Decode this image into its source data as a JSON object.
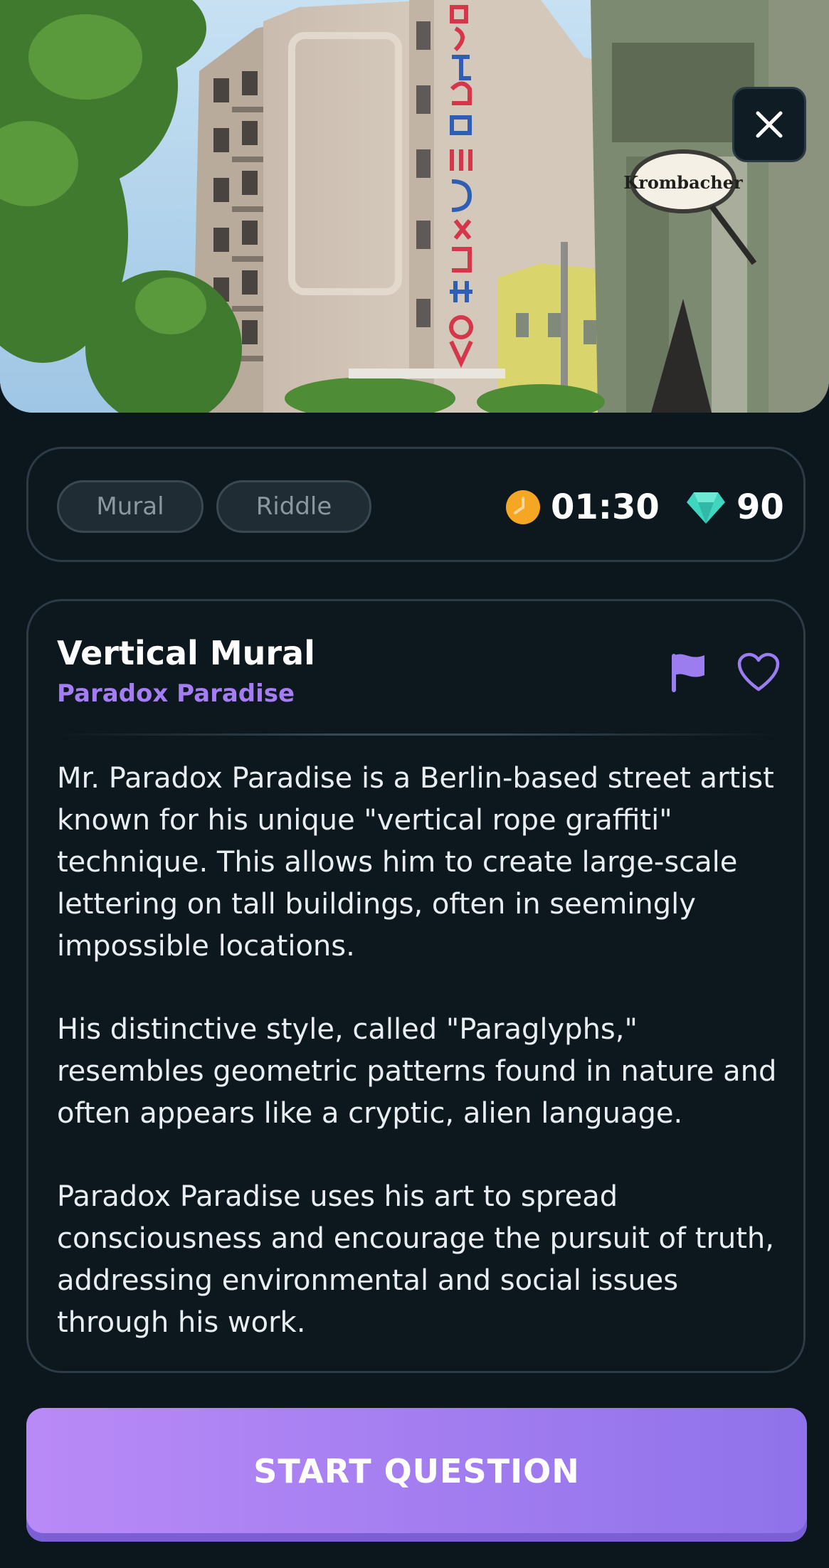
{
  "hero": {
    "image": "street-scene-photo",
    "sign_text": "Krombacher",
    "close_icon": "close-icon"
  },
  "meta": {
    "tags": [
      "Mural",
      "Riddle"
    ],
    "timer": "01:30",
    "timer_icon": "clock-icon",
    "gems": "90",
    "gems_icon": "diamond-icon"
  },
  "content": {
    "title": "Vertical Mural",
    "artist": "Paradox Paradise",
    "flag_icon": "flag-icon",
    "favorite_icon": "heart-icon",
    "paragraphs": [
      "Mr. Paradox Paradise is a Berlin-based street artist known for his unique \"vertical rope graffiti\" technique. This allows him to create large-scale lettering on tall buildings, often in seemingly impossible locations.",
      "His distinctive style, called \"Paraglyphs,\" resembles geometric patterns found in nature and often appears like a cryptic, alien language.",
      "Paradox Paradise uses his art to spread consciousness and encourage the pursuit of truth, addressing environmental and social issues through his work."
    ]
  },
  "cta": {
    "label": "START QUESTION"
  },
  "colors": {
    "background": "#0b161d",
    "accent": "#a57df2",
    "timer": "#f5a623",
    "gem": "#3fd6c0"
  }
}
